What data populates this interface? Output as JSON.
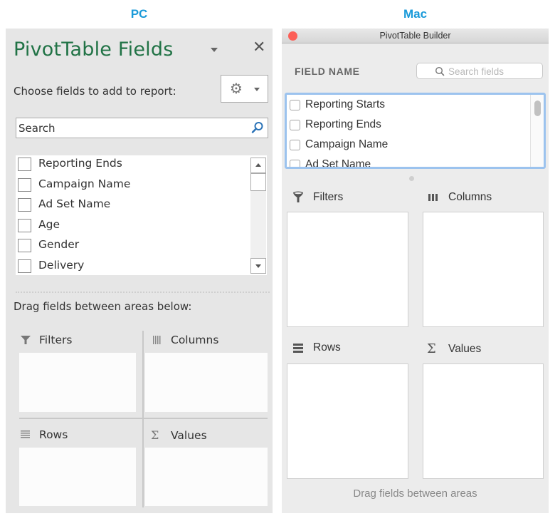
{
  "labels": {
    "pc": "PC",
    "mac": "Mac",
    "accent_color": "#1a9ad9"
  },
  "pc": {
    "title": "PivotTable Fields",
    "title_color": "#217346",
    "title_menu_icon": "caret-down-icon",
    "close_icon": "close-icon",
    "close_glyph": "✕",
    "choose_label": "Choose fields to add to report:",
    "settings_icon": "gear-icon",
    "gear_glyph": "⚙",
    "search": {
      "placeholder": "Search",
      "value": "",
      "icon": "search-icon"
    },
    "fields": [
      {
        "label": "Reporting Ends",
        "checked": false
      },
      {
        "label": "Campaign Name",
        "checked": false
      },
      {
        "label": "Ad Set Name",
        "checked": false
      },
      {
        "label": "Age",
        "checked": false
      },
      {
        "label": "Gender",
        "checked": false
      },
      {
        "label": "Delivery",
        "checked": false
      }
    ],
    "drag_instruction": "Drag fields between areas below:",
    "areas": {
      "filters": {
        "label": "Filters",
        "icon": "filter-icon"
      },
      "columns": {
        "label": "Columns",
        "icon": "columns-icon"
      },
      "rows": {
        "label": "Rows",
        "icon": "rows-icon"
      },
      "values": {
        "label": "Values",
        "icon": "sigma-icon",
        "glyph": "Σ"
      }
    }
  },
  "mac": {
    "window_title": "PivotTable Builder",
    "close_button_color": "#fc5f57",
    "field_name_header": "FIELD NAME",
    "search": {
      "placeholder": "Search fields",
      "value": "",
      "icon": "search-icon"
    },
    "fields": [
      {
        "label": "Reporting Starts",
        "checked": false
      },
      {
        "label": "Reporting Ends",
        "checked": false
      },
      {
        "label": "Campaign Name",
        "checked": false
      },
      {
        "label": "Ad Set Name",
        "checked": false
      }
    ],
    "list_focus_color": "#9cc3ee",
    "areas": {
      "filters": {
        "label": "Filters",
        "icon": "filter-icon"
      },
      "columns": {
        "label": "Columns",
        "icon": "columns-icon"
      },
      "rows": {
        "label": "Rows",
        "icon": "rows-icon"
      },
      "values": {
        "label": "Values",
        "icon": "sigma-icon",
        "glyph": "Σ"
      }
    },
    "footer": "Drag fields between areas"
  }
}
